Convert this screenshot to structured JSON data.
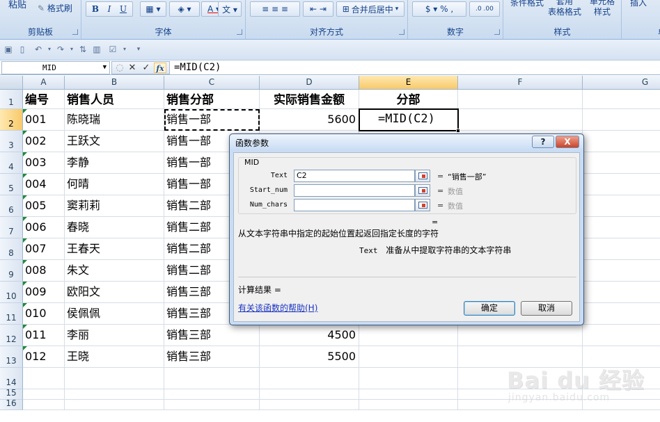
{
  "ribbon": {
    "groups": [
      {
        "label": "剪贴板"
      },
      {
        "label": "字体"
      },
      {
        "label": "对齐方式"
      },
      {
        "label": "数字"
      },
      {
        "label": "样式"
      },
      {
        "label": "单"
      }
    ],
    "paste_label": "粘贴",
    "format_painter_label": "格式刷",
    "merge_center_label": "合并后居中",
    "conditional_format_label": "条件格式",
    "table_format_label": "套用\n表格格式",
    "cell_style_label": "单元格\n样式",
    "insert_label": "插入"
  },
  "formula_bar": {
    "name_box": "MID",
    "formula": "=MID(C2)"
  },
  "columns": [
    "A",
    "B",
    "C",
    "D",
    "E",
    "F",
    "G"
  ],
  "rows": [
    "1",
    "2",
    "3",
    "4",
    "5",
    "6",
    "7",
    "8",
    "9",
    "10",
    "11",
    "12",
    "13",
    "14",
    "15",
    "16"
  ],
  "table": {
    "headers": [
      "编号",
      "销售人员",
      "销售分部",
      "实际销售金额",
      "分部"
    ],
    "rows": [
      [
        "001",
        "陈晓瑞",
        "销售一部",
        "5600",
        "=MID(C2)"
      ],
      [
        "002",
        "王跃文",
        "销售一部",
        "",
        ""
      ],
      [
        "003",
        "李静",
        "销售一部",
        "",
        ""
      ],
      [
        "004",
        "何晴",
        "销售一部",
        "",
        ""
      ],
      [
        "005",
        "窦莉莉",
        "销售二部",
        "",
        ""
      ],
      [
        "006",
        "春晓",
        "销售二部",
        "",
        ""
      ],
      [
        "007",
        "王春天",
        "销售二部",
        "",
        ""
      ],
      [
        "008",
        "朱文",
        "销售二部",
        "",
        ""
      ],
      [
        "009",
        "欧阳文",
        "销售三部",
        "",
        ""
      ],
      [
        "010",
        "侯佩佩",
        "销售三部",
        "",
        ""
      ],
      [
        "011",
        "李丽",
        "销售三部",
        "4500",
        ""
      ],
      [
        "012",
        "王晓",
        "销售三部",
        "5500",
        ""
      ]
    ]
  },
  "dialog": {
    "title": "函数参数",
    "help_btn": "?",
    "close_btn": "X",
    "function_name": "MID",
    "args": [
      {
        "label": "Text",
        "value": "C2",
        "result": "“销售一部”",
        "placeholder": false
      },
      {
        "label": "Start_num",
        "value": "",
        "result": "数值",
        "placeholder": true
      },
      {
        "label": "Num_chars",
        "value": "",
        "result": "数值",
        "placeholder": true
      }
    ],
    "eq_sign": "=",
    "description": "从文本字符串中指定的起始位置起返回指定长度的字符",
    "arg_desc_name": "Text",
    "arg_desc_text": "准备从中提取字符串的文本字符串",
    "calc_result": "计算结果 =",
    "help_link": "有关该函数的帮助(H)",
    "ok": "确定",
    "cancel": "取消"
  },
  "watermark": {
    "logo": "Bai du 经验",
    "url": "jingyan.baidu.com"
  }
}
